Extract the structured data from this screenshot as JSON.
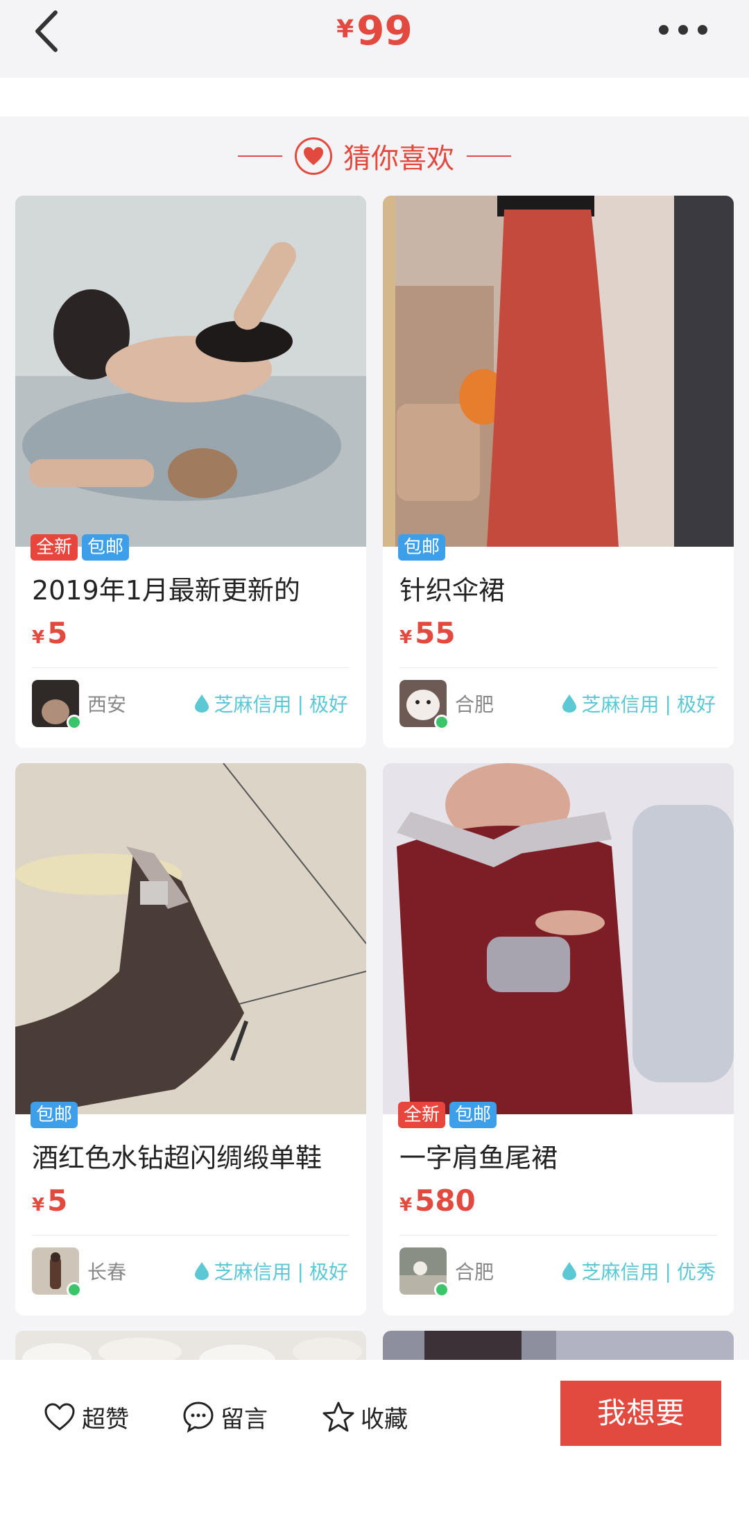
{
  "header": {
    "back_icon": "chevron-left-icon",
    "currency": "¥",
    "price": "99",
    "more_icon": "more-dots-icon"
  },
  "section": {
    "title": "猜你喜欢",
    "icon": "heart-icon"
  },
  "products": [
    {
      "badges": [
        "全新",
        "包邮"
      ],
      "title": "2019年1月最新更新的",
      "currency": "¥",
      "price": "5",
      "city": "西安",
      "credit_label": "芝麻信用",
      "credit_rating": "极好"
    },
    {
      "badges": [
        "包邮"
      ],
      "title": "针织伞裙",
      "currency": "¥",
      "price": "55",
      "city": "合肥",
      "credit_label": "芝麻信用",
      "credit_rating": "极好"
    },
    {
      "badges": [
        "包邮"
      ],
      "title": "酒红色水钻超闪绸缎单鞋",
      "currency": "¥",
      "price": "5",
      "city": "长春",
      "credit_label": "芝麻信用",
      "credit_rating": "极好"
    },
    {
      "badges": [
        "全新",
        "包邮"
      ],
      "title": "一字肩鱼尾裙",
      "currency": "¥",
      "price": "580",
      "city": "合肥",
      "credit_label": "芝麻信用",
      "credit_rating": "优秀"
    }
  ],
  "bottom_bar": {
    "like_label": "超赞",
    "comment_label": "留言",
    "favorite_label": "收藏",
    "want_label": "我想要"
  },
  "colors": {
    "accent": "#e24a40",
    "ship_badge": "#3d9ee9",
    "new_badge": "#e8453c",
    "credit": "#5cc8d4",
    "online": "#3cc46a"
  }
}
